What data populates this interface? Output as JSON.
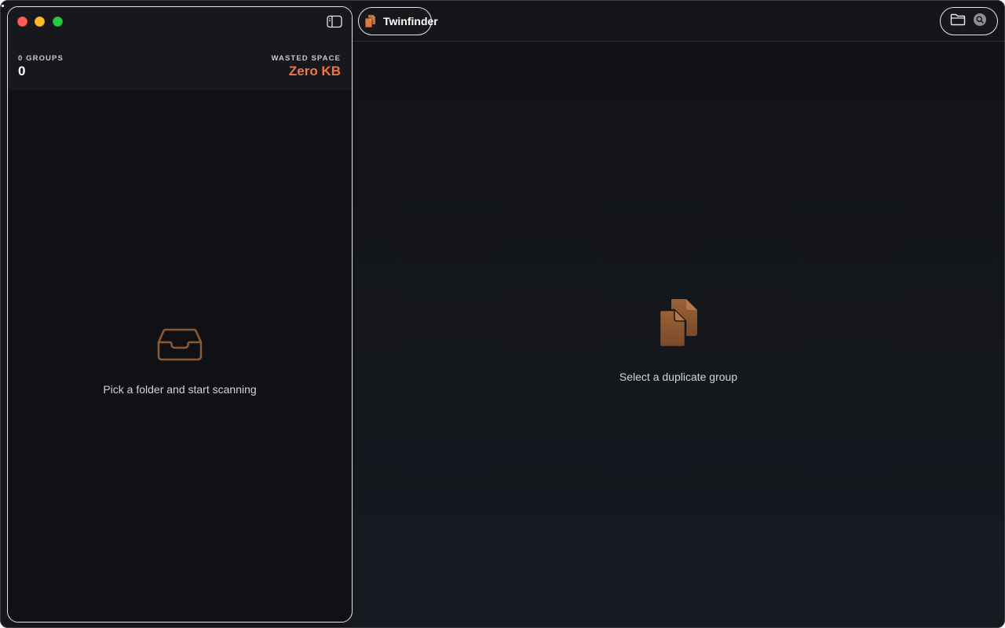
{
  "app": {
    "title": "Twinfinder"
  },
  "sidebar": {
    "groups_label": "0 GROUPS",
    "groups_value": "0",
    "wasted_label": "WASTED SPACE",
    "wasted_value": "Zero KB",
    "empty_icon": "tray-icon",
    "empty_text": "Pick a folder and start scanning"
  },
  "toolbar": {
    "open_folder_icon": "folder-icon",
    "scan_icon": "search-icon"
  },
  "main": {
    "empty_icon": "duplicate-documents-icon",
    "empty_text": "Select a duplicate group"
  },
  "colors": {
    "accent": "#f0773f",
    "icon_brown": "#8a5a34",
    "window_bg": "#15171c",
    "sidebar_bg": "#101114"
  }
}
